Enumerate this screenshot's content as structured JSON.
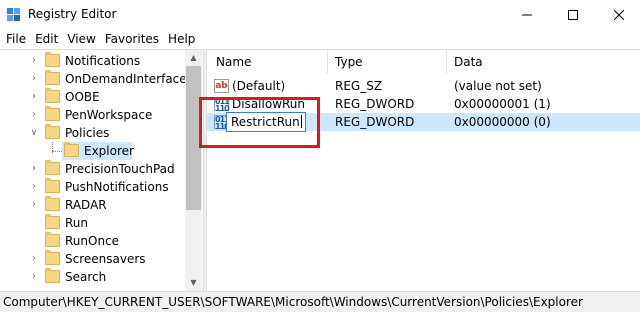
{
  "window": {
    "title": "Registry Editor"
  },
  "menu": [
    "File",
    "Edit",
    "View",
    "Favorites",
    "Help"
  ],
  "tree": {
    "items": [
      {
        "label": "Notifications",
        "expandable": true
      },
      {
        "label": "OnDemandInterfaceCa",
        "expandable": true
      },
      {
        "label": "OOBE",
        "expandable": true
      },
      {
        "label": "PenWorkspace",
        "expandable": true
      },
      {
        "label": "Policies",
        "expandable": true,
        "expanded": true
      },
      {
        "label": "Explorer",
        "expandable": false,
        "selected": true
      },
      {
        "label": "PrecisionTouchPad",
        "expandable": true
      },
      {
        "label": "PushNotifications",
        "expandable": true
      },
      {
        "label": "RADAR",
        "expandable": true
      },
      {
        "label": "Run",
        "expandable": false
      },
      {
        "label": "RunOnce",
        "expandable": false
      },
      {
        "label": "Screensavers",
        "expandable": true
      },
      {
        "label": "Search",
        "expandable": true
      }
    ]
  },
  "list": {
    "columns": [
      "Name",
      "Type",
      "Data"
    ],
    "rows": [
      {
        "icon": "string-value-icon",
        "name": "(Default)",
        "type": "REG_SZ",
        "data": "(value not set)"
      },
      {
        "icon": "dword-value-icon",
        "name": "DisallowRun",
        "type": "REG_DWORD",
        "data": "0x00000001 (1)"
      },
      {
        "icon": "dword-value-icon",
        "name": "RestrictRun",
        "type": "REG_DWORD",
        "data": "0x00000000 (0)",
        "selected": true,
        "editing": true
      }
    ]
  },
  "icons": {
    "sz": "ab",
    "dword_top": "011",
    "dword_bottom": "110"
  },
  "status": {
    "path": "Computer\\HKEY_CURRENT_USER\\SOFTWARE\\Microsoft\\Windows\\CurrentVersion\\Policies\\Explorer"
  },
  "colors": {
    "selection": "#cce8ff",
    "annotation": "#e01818",
    "folder": "#f5d682"
  }
}
